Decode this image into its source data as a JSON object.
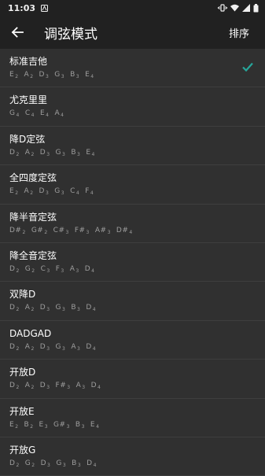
{
  "status": {
    "time": "11:03"
  },
  "appbar": {
    "title": "调弦模式",
    "sort_label": "排序"
  },
  "colors": {
    "accent": "#26a69a",
    "background": "#303030",
    "bar": "#212121"
  },
  "tunings": [
    {
      "name": "标准吉他",
      "selected": true,
      "notes": [
        [
          "E",
          "2"
        ],
        [
          "A",
          "2"
        ],
        [
          "D",
          "3"
        ],
        [
          "G",
          "3"
        ],
        [
          "B",
          "3"
        ],
        [
          "E",
          "4"
        ]
      ]
    },
    {
      "name": "尤克里里",
      "selected": false,
      "notes": [
        [
          "G",
          "4"
        ],
        [
          "C",
          "4"
        ],
        [
          "E",
          "4"
        ],
        [
          "A",
          "4"
        ]
      ]
    },
    {
      "name": "降D定弦",
      "selected": false,
      "notes": [
        [
          "D",
          "2"
        ],
        [
          "A",
          "2"
        ],
        [
          "D",
          "3"
        ],
        [
          "G",
          "3"
        ],
        [
          "B",
          "3"
        ],
        [
          "E",
          "4"
        ]
      ]
    },
    {
      "name": "全四度定弦",
      "selected": false,
      "notes": [
        [
          "E",
          "2"
        ],
        [
          "A",
          "2"
        ],
        [
          "D",
          "3"
        ],
        [
          "G",
          "3"
        ],
        [
          "C",
          "4"
        ],
        [
          "F",
          "4"
        ]
      ]
    },
    {
      "name": "降半音定弦",
      "selected": false,
      "notes": [
        [
          "D#",
          "2"
        ],
        [
          "G#",
          "2"
        ],
        [
          "C#",
          "3"
        ],
        [
          "F#",
          "3"
        ],
        [
          "A#",
          "3"
        ],
        [
          "D#",
          "4"
        ]
      ]
    },
    {
      "name": "降全音定弦",
      "selected": false,
      "notes": [
        [
          "D",
          "2"
        ],
        [
          "G",
          "2"
        ],
        [
          "C",
          "3"
        ],
        [
          "F",
          "3"
        ],
        [
          "A",
          "3"
        ],
        [
          "D",
          "4"
        ]
      ]
    },
    {
      "name": "双降D",
      "selected": false,
      "notes": [
        [
          "D",
          "2"
        ],
        [
          "A",
          "2"
        ],
        [
          "D",
          "3"
        ],
        [
          "G",
          "3"
        ],
        [
          "B",
          "3"
        ],
        [
          "D",
          "4"
        ]
      ]
    },
    {
      "name": "DADGAD",
      "selected": false,
      "notes": [
        [
          "D",
          "2"
        ],
        [
          "A",
          "2"
        ],
        [
          "D",
          "3"
        ],
        [
          "G",
          "3"
        ],
        [
          "A",
          "3"
        ],
        [
          "D",
          "4"
        ]
      ]
    },
    {
      "name": "开放D",
      "selected": false,
      "notes": [
        [
          "D",
          "2"
        ],
        [
          "A",
          "2"
        ],
        [
          "D",
          "3"
        ],
        [
          "F#",
          "3"
        ],
        [
          "A",
          "3"
        ],
        [
          "D",
          "4"
        ]
      ]
    },
    {
      "name": "开放E",
      "selected": false,
      "notes": [
        [
          "E",
          "2"
        ],
        [
          "B",
          "2"
        ],
        [
          "E",
          "3"
        ],
        [
          "G#",
          "3"
        ],
        [
          "B",
          "3"
        ],
        [
          "E",
          "4"
        ]
      ]
    },
    {
      "name": "开放G",
      "selected": false,
      "notes": [
        [
          "D",
          "2"
        ],
        [
          "G",
          "2"
        ],
        [
          "D",
          "3"
        ],
        [
          "G",
          "3"
        ],
        [
          "B",
          "3"
        ],
        [
          "D",
          "4"
        ]
      ]
    }
  ]
}
